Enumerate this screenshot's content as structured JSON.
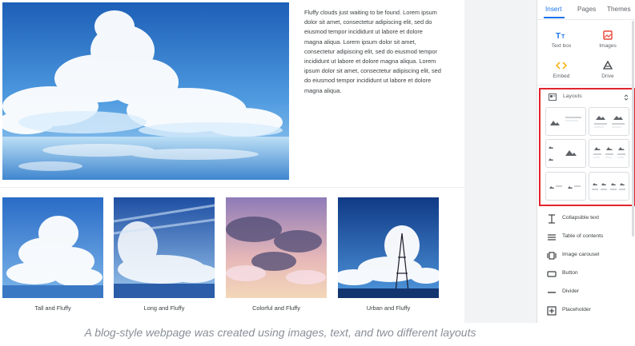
{
  "page": {
    "hero_text": "Fluffy clouds just waiting to be found. Lorem ipsum dolor sit amet, consectetur adipiscing elit, sed do eiusmod tempor incididunt ut labore et dolore magna aliqua. Lorem ipsum dolor sit amet, consectetur adipiscing elit, sed do eiusmod tempor incididunt ut labore et dolore magna aliqua. Lorem ipsum dolor sit amet, consectetur adipiscing elit, sed do eiusmod tempor incididunt ut labore et dolore magna aliqua.",
    "gallery": [
      {
        "caption": "Tall and Fluffy"
      },
      {
        "caption": "Long and Fluffy"
      },
      {
        "caption": "Colorful and Fluffy"
      },
      {
        "caption": "Urban and Fluffy"
      }
    ]
  },
  "panel": {
    "tabs": [
      {
        "label": "Insert",
        "active": true
      },
      {
        "label": "Pages",
        "active": false
      },
      {
        "label": "Themes",
        "active": false
      }
    ],
    "insert_items": [
      {
        "label": "Text box",
        "icon": "text-box-icon"
      },
      {
        "label": "Images",
        "icon": "image-icon"
      },
      {
        "label": "Embed",
        "icon": "embed-icon"
      },
      {
        "label": "Drive",
        "icon": "drive-icon"
      }
    ],
    "layouts": {
      "title": "Layouts"
    },
    "elements": [
      {
        "label": "Collapsible text",
        "icon": "collapsible-text-icon"
      },
      {
        "label": "Table of contents",
        "icon": "table-of-contents-icon"
      },
      {
        "label": "Image carousel",
        "icon": "image-carousel-icon"
      },
      {
        "label": "Button",
        "icon": "button-icon"
      },
      {
        "label": "Divider",
        "icon": "divider-icon"
      },
      {
        "label": "Placeholder",
        "icon": "placeholder-icon"
      }
    ]
  },
  "caption": "A blog-style webpage was created using images, text, and two different layouts",
  "colors": {
    "accent": "#1a73e8",
    "highlight": "#e0252e",
    "images_icon": "#ea4335",
    "embed_icon": "#f9ab00"
  }
}
